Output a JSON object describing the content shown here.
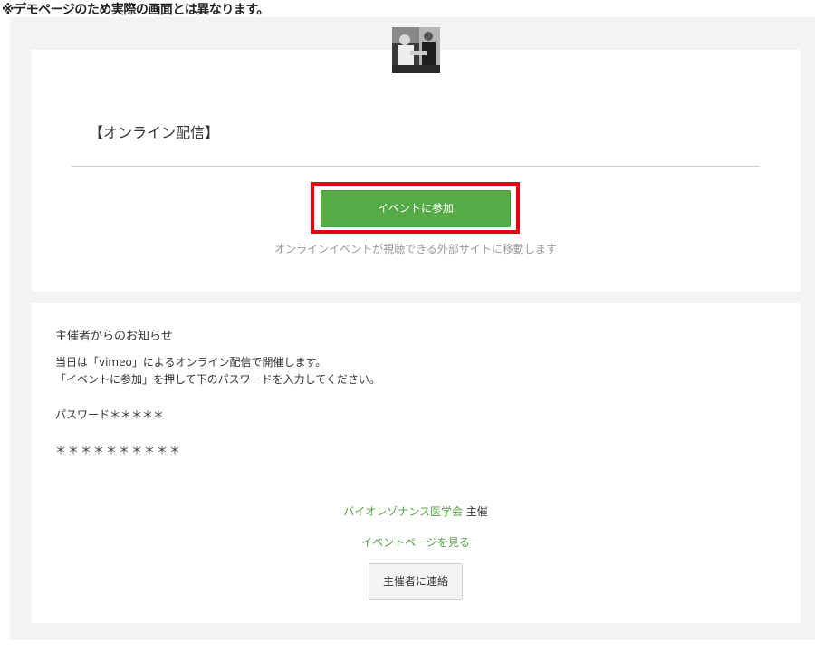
{
  "demo_notice": "※デモページのため実際の画面とは異なります。",
  "event": {
    "title": "【オンライン配信】",
    "thumbnail_icon": "organizer-photo"
  },
  "join": {
    "button_label": "イベントに参加",
    "note": "オンラインイベントが視聴できる外部サイトに移動します",
    "highlight_color": "#e60012",
    "button_color": "#56ab47"
  },
  "notice": {
    "heading": "主催者からのお知らせ",
    "line1": "当日は「vimeo」によるオンライン配信で開催します。",
    "line2": "「イベントに参加」を押して下のパスワードを入力してください。",
    "password_label": "パスワード＊＊＊＊＊",
    "password_value": "＊＊＊＊＊＊＊＊＊＊"
  },
  "organizer": {
    "name": "バイオレゾナンス医学会",
    "suffix": " 主催",
    "link_color": "#56a046"
  },
  "event_page_link": "イベントページを見る",
  "contact_button": "主催者に連絡"
}
